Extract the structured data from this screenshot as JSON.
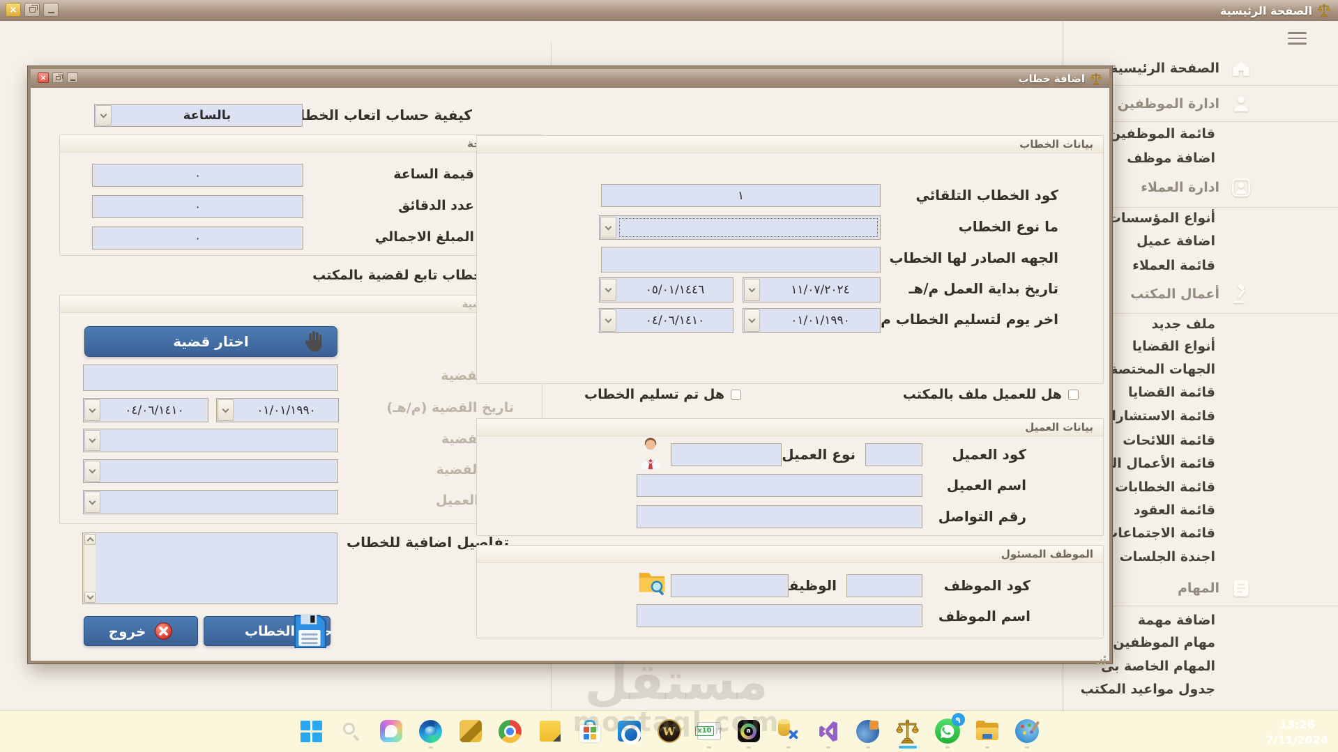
{
  "main_window": {
    "title": "الصفحة الرئيسية",
    "sidebar": {
      "items": [
        {
          "label": "الصفحة الرئيسية",
          "icon": "home"
        },
        {
          "label": "ادارة الموظفين",
          "icon": "employees",
          "header": true
        },
        {
          "label": "قائمة الموظفين"
        },
        {
          "label": "اضافة موظف"
        },
        {
          "label": "ادارة العملاء",
          "icon": "clients",
          "header": true
        },
        {
          "label": "أنواع المؤسسات"
        },
        {
          "label": "اضافة عميل"
        },
        {
          "label": "قائمة العملاء"
        },
        {
          "label": "أعمال المكتب",
          "icon": "gavel",
          "header": true
        },
        {
          "label": "ملف جديد"
        },
        {
          "label": "أنواع القضايا"
        },
        {
          "label": "الجهات المختصة"
        },
        {
          "label": "قائمة القضايا"
        },
        {
          "label": "قائمة الاستشارات"
        },
        {
          "label": "قائمة اللائحات"
        },
        {
          "label": "قائمة الأعمال الكتابية"
        },
        {
          "label": "قائمة الخطابات"
        },
        {
          "label": "قائمة العقود"
        },
        {
          "label": "قائمة الاجتماعات"
        },
        {
          "label": "اجندة الجلسات"
        },
        {
          "label": "المهام",
          "icon": "tasks",
          "header": true
        },
        {
          "label": "اضافة مهمة"
        },
        {
          "label": "مهام الموظفين"
        },
        {
          "label": "المهام الخاصة بى"
        },
        {
          "label": "جدول مواعيد المكتب"
        }
      ]
    }
  },
  "dialog": {
    "title": "اضافة خطاب",
    "fee_method": {
      "label": "كيفية حساب اتعاب الخطاب",
      "value": "بالساعة"
    },
    "fees_group": {
      "title": "أتعاب اللائحة",
      "rows": [
        {
          "label": "قيمة الساعة",
          "value": "٠"
        },
        {
          "label": "عدد الدقائق",
          "value": "٠"
        },
        {
          "label": "المبلغ الاجمالي",
          "value": "٠"
        }
      ]
    },
    "case_checkbox": "هل الخطاب تابع لقضية بالمكتب",
    "case_group": {
      "title": "بيانات القضية",
      "choose_button": "اختار قضية",
      "code_label": "كود القضية",
      "date_label": "تاريخ القضية (م/هـ)",
      "date_hijri": "٠٤/٠٦/١٤١٠",
      "date_greg": "٠١/٠١/١٩٩٠",
      "type_label": "نوع القضية",
      "status_label": "حالة القضية",
      "client_role_label": "صفة العميل"
    },
    "details_label": "تفاصيل اضافية للخطاب",
    "exit_button": "خروج",
    "save_button": "حفظ الخطاب",
    "letter_group": {
      "title": "بيانات الخطاب",
      "code_label": "كود الخطاب التلقائي",
      "code_value": "١",
      "type_label": "ما نوع الخطاب",
      "issuer_label": "الجهه الصادر لها الخطاب",
      "start_label": "تاريخ بداية العمل م/هـ",
      "start_hijri": "٠٥/٠١/١٤٤٦",
      "start_greg": "١١/٠٧/٢٠٢٤",
      "deadline_label": "اخر يوم لتسليم الخطاب م/هـ",
      "deadline_hijri": "٠٤/٠٦/١٤١٠",
      "deadline_greg": "٠١/٠١/١٩٩٠"
    },
    "client_file_checkbox": "هل للعميل ملف بالمكتب",
    "delivered_checkbox": "هل تم تسليم الخطاب",
    "client_group": {
      "title": "بيانات العميل",
      "code_label": "كود العميل",
      "type_label": "نوع العميل",
      "name_label": "اسم العميل",
      "phone_label": "رقم التواصل"
    },
    "employee_group": {
      "title": "الموظف المسئول",
      "code_label": "كود الموظف",
      "job_label": "الوظيفة",
      "name_label": "اسم الموظف"
    }
  },
  "taskbar": {
    "icons": [
      {
        "name": "windows-start"
      },
      {
        "name": "search"
      },
      {
        "name": "copilot"
      },
      {
        "name": "edge",
        "running": true
      },
      {
        "name": "gold-folder-app"
      },
      {
        "name": "chrome"
      },
      {
        "name": "sticky-notes"
      },
      {
        "name": "microsoft-store"
      },
      {
        "name": "outlook"
      },
      {
        "name": "world-of-warcraft"
      },
      {
        "name": "x10-terminal",
        "running": true
      },
      {
        "name": "a-app",
        "running": true
      },
      {
        "name": "sql-tools",
        "running": true
      },
      {
        "name": "visual-studio",
        "running": true
      },
      {
        "name": "puzzle-app",
        "running": true
      },
      {
        "name": "law-app",
        "active": true
      },
      {
        "name": "whatsapp",
        "running": true,
        "badge": "٩"
      },
      {
        "name": "file-explorer",
        "running": true
      },
      {
        "name": "paint",
        "running": true
      }
    ],
    "whatsapp_badge": "٩",
    "clock": {
      "time": "13:26",
      "date": "7/11/2024"
    }
  },
  "watermark": {
    "line1": "مستقل",
    "line2": "mostaql.com"
  }
}
